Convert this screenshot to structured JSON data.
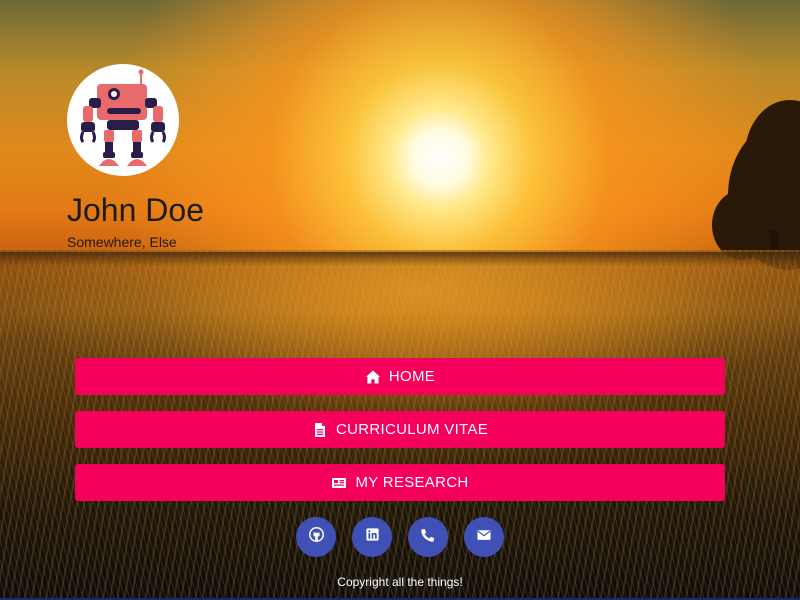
{
  "profile": {
    "name": "John Doe",
    "location": "Somewhere, Else"
  },
  "nav": {
    "home": {
      "label": "HOME",
      "icon": "home-icon"
    },
    "cv": {
      "label": "CURRICULUM VITAE",
      "icon": "file-icon"
    },
    "research": {
      "label": "MY RESEARCH",
      "icon": "newspaper-icon"
    }
  },
  "social": [
    {
      "icon": "github-icon"
    },
    {
      "icon": "linkedin-icon"
    },
    {
      "icon": "phone-icon"
    },
    {
      "icon": "email-icon"
    }
  ],
  "footer": {
    "copyright": "Copyright all the things!"
  },
  "colors": {
    "button": "#f5005a",
    "social": "#3f51b5",
    "robot_body": "#e86a6a",
    "robot_dark": "#2b1d4a"
  }
}
